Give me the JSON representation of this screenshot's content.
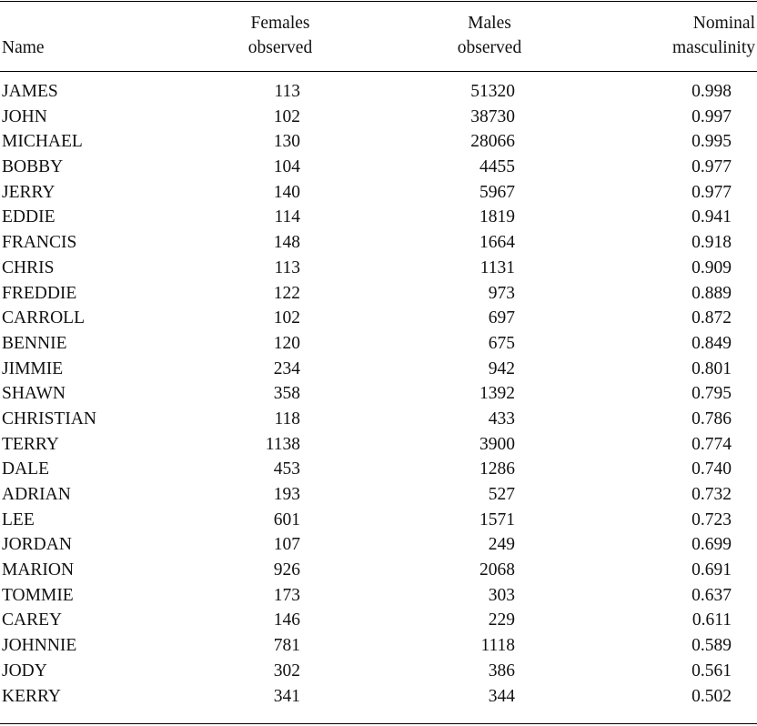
{
  "table": {
    "headers": {
      "name": [
        "Name"
      ],
      "females_observed": [
        "Females",
        "observed"
      ],
      "males_observed": [
        "Males",
        "observed"
      ],
      "nominal_masculinity": [
        "Nominal",
        "masculinity"
      ]
    },
    "rows": [
      {
        "name": "JAMES",
        "females": "113",
        "males": "51320",
        "masculinity": "0.998"
      },
      {
        "name": "JOHN",
        "females": "102",
        "males": "38730",
        "masculinity": "0.997"
      },
      {
        "name": "MICHAEL",
        "females": "130",
        "males": "28066",
        "masculinity": "0.995"
      },
      {
        "name": "BOBBY",
        "females": "104",
        "males": "4455",
        "masculinity": "0.977"
      },
      {
        "name": "JERRY",
        "females": "140",
        "males": "5967",
        "masculinity": "0.977"
      },
      {
        "name": "EDDIE",
        "females": "114",
        "males": "1819",
        "masculinity": "0.941"
      },
      {
        "name": "FRANCIS",
        "females": "148",
        "males": "1664",
        "masculinity": "0.918"
      },
      {
        "name": "CHRIS",
        "females": "113",
        "males": "1131",
        "masculinity": "0.909"
      },
      {
        "name": "FREDDIE",
        "females": "122",
        "males": "973",
        "masculinity": "0.889"
      },
      {
        "name": "CARROLL",
        "females": "102",
        "males": "697",
        "masculinity": "0.872"
      },
      {
        "name": "BENNIE",
        "females": "120",
        "males": "675",
        "masculinity": "0.849"
      },
      {
        "name": "JIMMIE",
        "females": "234",
        "males": "942",
        "masculinity": "0.801"
      },
      {
        "name": "SHAWN",
        "females": "358",
        "males": "1392",
        "masculinity": "0.795"
      },
      {
        "name": "CHRISTIAN",
        "females": "118",
        "males": "433",
        "masculinity": "0.786"
      },
      {
        "name": "TERRY",
        "females": "1138",
        "males": "3900",
        "masculinity": "0.774"
      },
      {
        "name": "DALE",
        "females": "453",
        "males": "1286",
        "masculinity": "0.740"
      },
      {
        "name": "ADRIAN",
        "females": "193",
        "males": "527",
        "masculinity": "0.732"
      },
      {
        "name": "LEE",
        "females": "601",
        "males": "1571",
        "masculinity": "0.723"
      },
      {
        "name": "JORDAN",
        "females": "107",
        "males": "249",
        "masculinity": "0.699"
      },
      {
        "name": "MARION",
        "females": "926",
        "males": "2068",
        "masculinity": "0.691"
      },
      {
        "name": "TOMMIE",
        "females": "173",
        "males": "303",
        "masculinity": "0.637"
      },
      {
        "name": "CAREY",
        "females": "146",
        "males": "229",
        "masculinity": "0.611"
      },
      {
        "name": "JOHNNIE",
        "females": "781",
        "males": "1118",
        "masculinity": "0.589"
      },
      {
        "name": "JODY",
        "females": "302",
        "males": "386",
        "masculinity": "0.561"
      },
      {
        "name": "KERRY",
        "females": "341",
        "males": "344",
        "masculinity": "0.502"
      }
    ]
  }
}
